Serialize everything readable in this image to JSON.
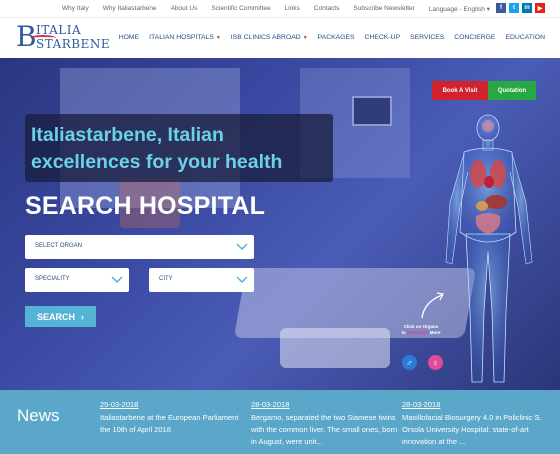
{
  "topbar": {
    "links": [
      "Why Italy",
      "Why Italiastarbene",
      "About Us",
      "Scientific Committee",
      "Links",
      "Contacts",
      "Subscribe Newsletter",
      "Language - English"
    ],
    "language_caret": "▾",
    "social": [
      {
        "icon": "facebook-icon",
        "glyph": "f",
        "color": "#3b5998"
      },
      {
        "icon": "twitter-icon",
        "glyph": "t",
        "color": "#1da1f2"
      },
      {
        "icon": "linkedin-icon",
        "glyph": "in",
        "color": "#0077b5"
      },
      {
        "icon": "youtube-icon",
        "glyph": "▶",
        "color": "#e62117"
      }
    ]
  },
  "logo": {
    "initial": "B",
    "line1": "ITALIA",
    "line2": "STARBENE"
  },
  "nav": {
    "items": [
      {
        "label": "HOME",
        "dropdown": false
      },
      {
        "label": "ITALIAN HOSPITALS",
        "dropdown": true
      },
      {
        "label": "ISB CLINICS ABROAD",
        "dropdown": true
      },
      {
        "label": "PACKAGES",
        "dropdown": false
      },
      {
        "label": "CHECK-UP",
        "dropdown": false
      },
      {
        "label": "SERVICES",
        "dropdown": false
      },
      {
        "label": "CONCIERGE",
        "dropdown": false
      },
      {
        "label": "EDUCATION",
        "dropdown": false
      }
    ]
  },
  "hero": {
    "book_label": "Book A Visit",
    "quote_label": "Quotation",
    "headline": "Italiastarbene, Italian excellences for your health",
    "search_title": "SEARCH HOSPITAL",
    "select_organ": "SELECT ORGAN",
    "speciality": "SPECIALITY",
    "city": "CITY",
    "search_label": "SEARCH",
    "search_arrow": "›",
    "organ_hint_a": "Click on Organs",
    "organ_hint_b": "to ",
    "organ_hint_hl": "EXPLORE",
    "organ_hint_c": " More",
    "male_glyph": "♂",
    "female_glyph": "♀"
  },
  "colors": {
    "nav": "#244e8e",
    "book": "#d2222d",
    "quote": "#26a843",
    "news_bg": "#5aa7c9",
    "headline": "#6ad2e8"
  },
  "news": {
    "title": "News",
    "items": [
      {
        "date": "25-03-2018",
        "text": "Italiastarbene at the European Parliament the 10th of April 2018"
      },
      {
        "date": "28-03-2018",
        "text": "Bergamo, separated the two Siamese twins with the common liver. The small ones, born in August, were unit..."
      },
      {
        "date": "28-03-2018",
        "text": "Maxillofacial Biosurgery 4.0 in Policlinic S. Orsola University Hospital: state-of-art innovation at the ..."
      }
    ]
  }
}
